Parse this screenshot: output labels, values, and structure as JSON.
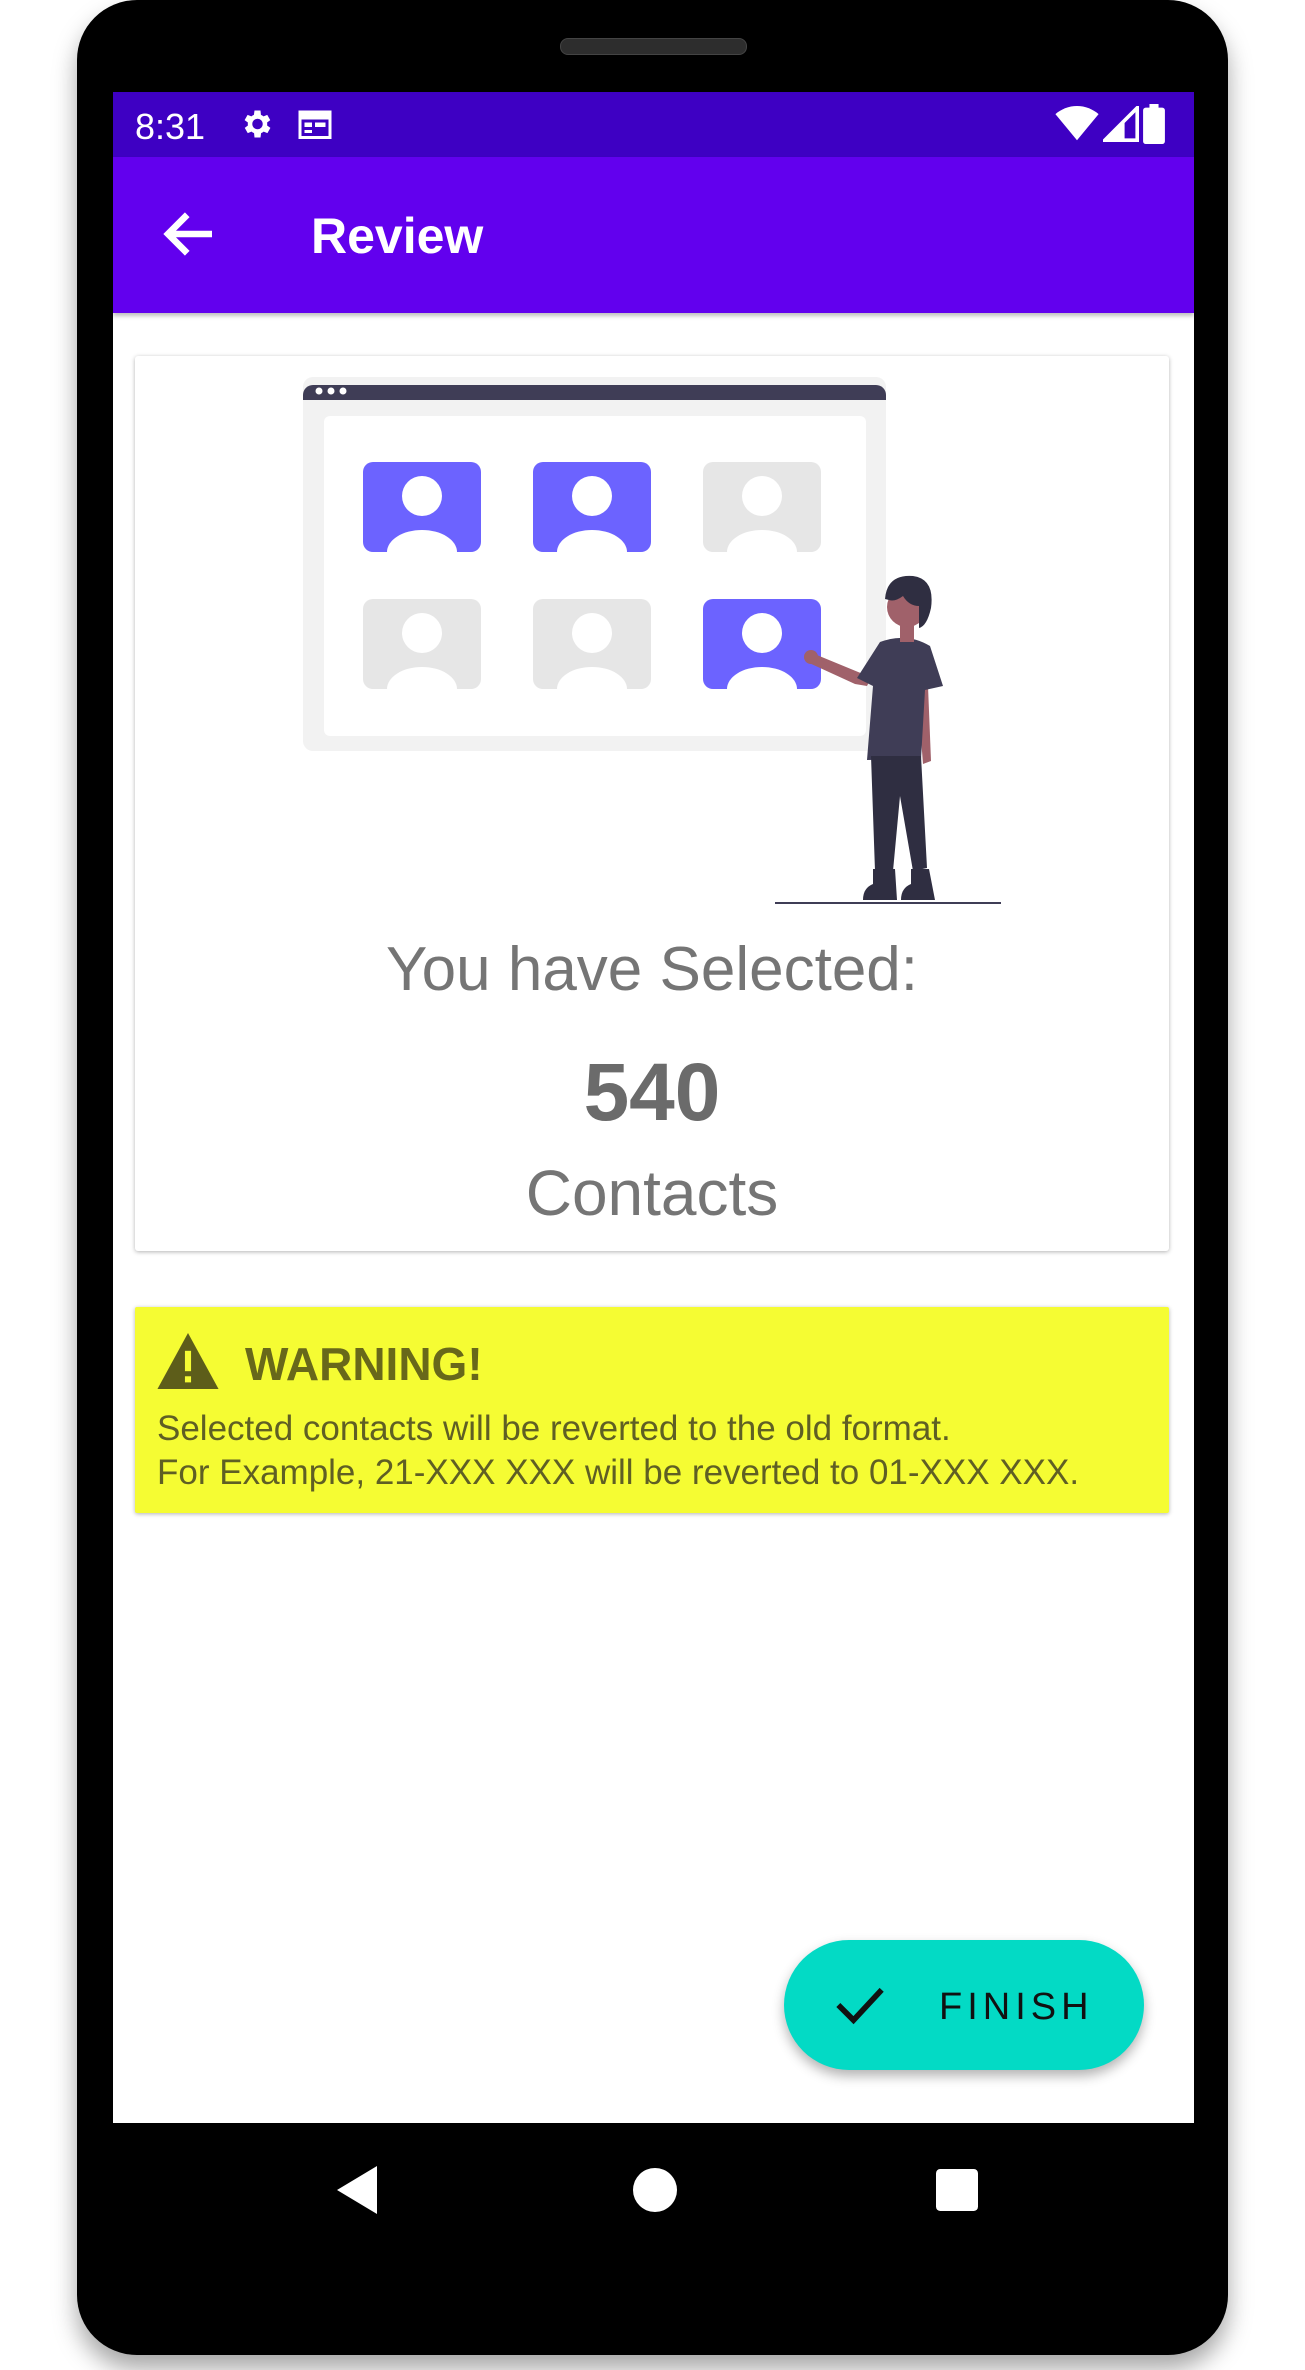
{
  "status_bar": {
    "time": "8:31",
    "left_icons": [
      "gear-icon",
      "calendar-icon"
    ],
    "right_icons": [
      "wifi-icon",
      "signal-icon",
      "battery-icon"
    ],
    "background": "#3e00c3"
  },
  "app_bar": {
    "title": "Review",
    "back_icon": "arrow-back-icon",
    "background": "#6200ee"
  },
  "summary_card": {
    "label": "You have Selected:",
    "count": "540",
    "unit": "Contacts",
    "illustration": "person-selecting-contacts-illustration"
  },
  "warning": {
    "title": "WARNING!",
    "line1": "Selected contacts will be reverted to the old format.",
    "line2": "For Example, 21-XXX XXX will be reverted to 01-XXX XXX.",
    "icon": "warning-icon",
    "background": "#f5fc33"
  },
  "fab": {
    "label": "FINISH",
    "icon": "check-icon",
    "background": "#03dac5"
  },
  "nav_bar": {
    "icons": [
      "nav-back-icon",
      "nav-home-icon",
      "nav-recents-icon"
    ]
  },
  "accent_colors": {
    "primary": "#6200ee",
    "illustration_active": "#6c63ff",
    "illustration_inactive": "#e6e6e6"
  }
}
